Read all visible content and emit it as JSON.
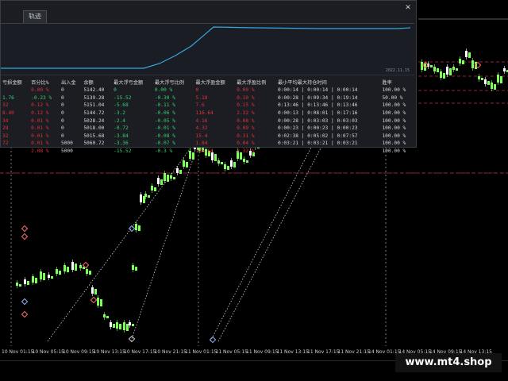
{
  "window": {
    "tab_label": "轨迹",
    "close_glyph": "✕",
    "equity_date_label": "2022.11.15"
  },
  "stats": {
    "headers": [
      "亏损金额",
      "百分比%",
      "出入金",
      "余额",
      "最大浮亏金额",
      "最大浮亏比例",
      "最大浮盈金额",
      "最大浮盈比例",
      "最小平均最大持仓时间",
      "胜率"
    ],
    "rows": [
      {
        "loss": "",
        "pct": "0.00 %",
        "io": "0",
        "bal": "5142.40",
        "mfl": "0",
        "mflp": "0.00 %",
        "mfg": "0",
        "mfgp": "0.00 %",
        "time": "0:00:14 | 0:00:14 | 0:00:14",
        "win": "100.00 %"
      },
      {
        "loss": "1.76",
        "pct": "-0.23 %",
        "io": "0",
        "bal": "5139.28",
        "mfl": "-15.52",
        "mflp": "-0.30 %",
        "mfg": "5.18",
        "mfgp": "0.10 %",
        "time": "0:00:28 | 0:09:34 | 0:19:14",
        "win": "50.00 %"
      },
      {
        "loss": "32",
        "pct": "0.12 %",
        "io": "0",
        "bal": "5151.04",
        "mfl": "-5.68",
        "mflp": "-0.11 %",
        "mfg": "7.6",
        "mfgp": "0.15 %",
        "time": "0:13:46 | 0:13:46 | 0:13:46",
        "win": "100.00 %"
      },
      {
        "loss": "8.40",
        "pct": "0.12 %",
        "io": "0",
        "bal": "5144.72",
        "mfl": "-3.2",
        "mflp": "-0.06 %",
        "mfg": "116.64",
        "mfgp": "2.32 %",
        "time": "0:00:13 | 0:08:01 | 0:17:16",
        "win": "100.00 %"
      },
      {
        "loss": "34",
        "pct": "0.01 %",
        "io": "0",
        "bal": "5028.24",
        "mfl": "-2.4",
        "mflp": "-0.05 %",
        "mfg": "4.16",
        "mfgp": "0.08 %",
        "time": "0:00:28 | 0:03:03 | 0:03:03",
        "win": "100.00 %"
      },
      {
        "loss": "28",
        "pct": "0.01 %",
        "io": "0",
        "bal": "5018.00",
        "mfl": "-0.72",
        "mflp": "-0.01 %",
        "mfg": "4.32",
        "mfgp": "0.09 %",
        "time": "0:00:23 | 0:00:23 | 0:00:23",
        "win": "100.00 %"
      },
      {
        "loss": "32",
        "pct": "0.01 %",
        "io": "0",
        "bal": "5015.68",
        "mfl": "-3.84",
        "mflp": "-0.08 %",
        "mfg": "15.4",
        "mfgp": "0.31 %",
        "time": "0:02:38 | 0:05:02 | 0:07:57",
        "win": "100.00 %"
      },
      {
        "loss": "72",
        "pct": "0.01 %",
        "io": "5000",
        "bal": "5060.72",
        "mfl": "-3.36",
        "mflp": "-0.07 %",
        "mfg": "1.84",
        "mfgp": "0.04 %",
        "time": "0:03:21 | 0:03:21 | 0:03:21",
        "win": "100.00 %"
      },
      {
        "loss": "",
        "pct": "2.08 %",
        "io": "5000",
        "bal": "",
        "mfl": "-15.52",
        "mflp": "-0.3 %",
        "mfg": "116.64",
        "mfgp": "2.32 %",
        "time": "",
        "win": "100.00 %"
      }
    ]
  },
  "time_axis": {
    "labels": [
      "10 Nov 01:15",
      "10 Nov 05:15",
      "10 Nov 09:15",
      "10 Nov 13:15",
      "10 Nov 17:15",
      "10 Nov 21:15",
      "11 Nov 01:15",
      "11 Nov 05:15",
      "11 Nov 09:15",
      "11 Nov 13:15",
      "11 Nov 17:15",
      "11 Nov 21:15",
      "14 Nov 01:15",
      "14 Nov 05:15",
      "14 Nov 09:15",
      "14 Nov 13:15"
    ]
  },
  "watermark": "www.mt4.shop",
  "colors": {
    "bull": "#7dff5a",
    "bear": "#ffffff",
    "level": "#c0304a",
    "equity_line": "#36a8e0"
  }
}
